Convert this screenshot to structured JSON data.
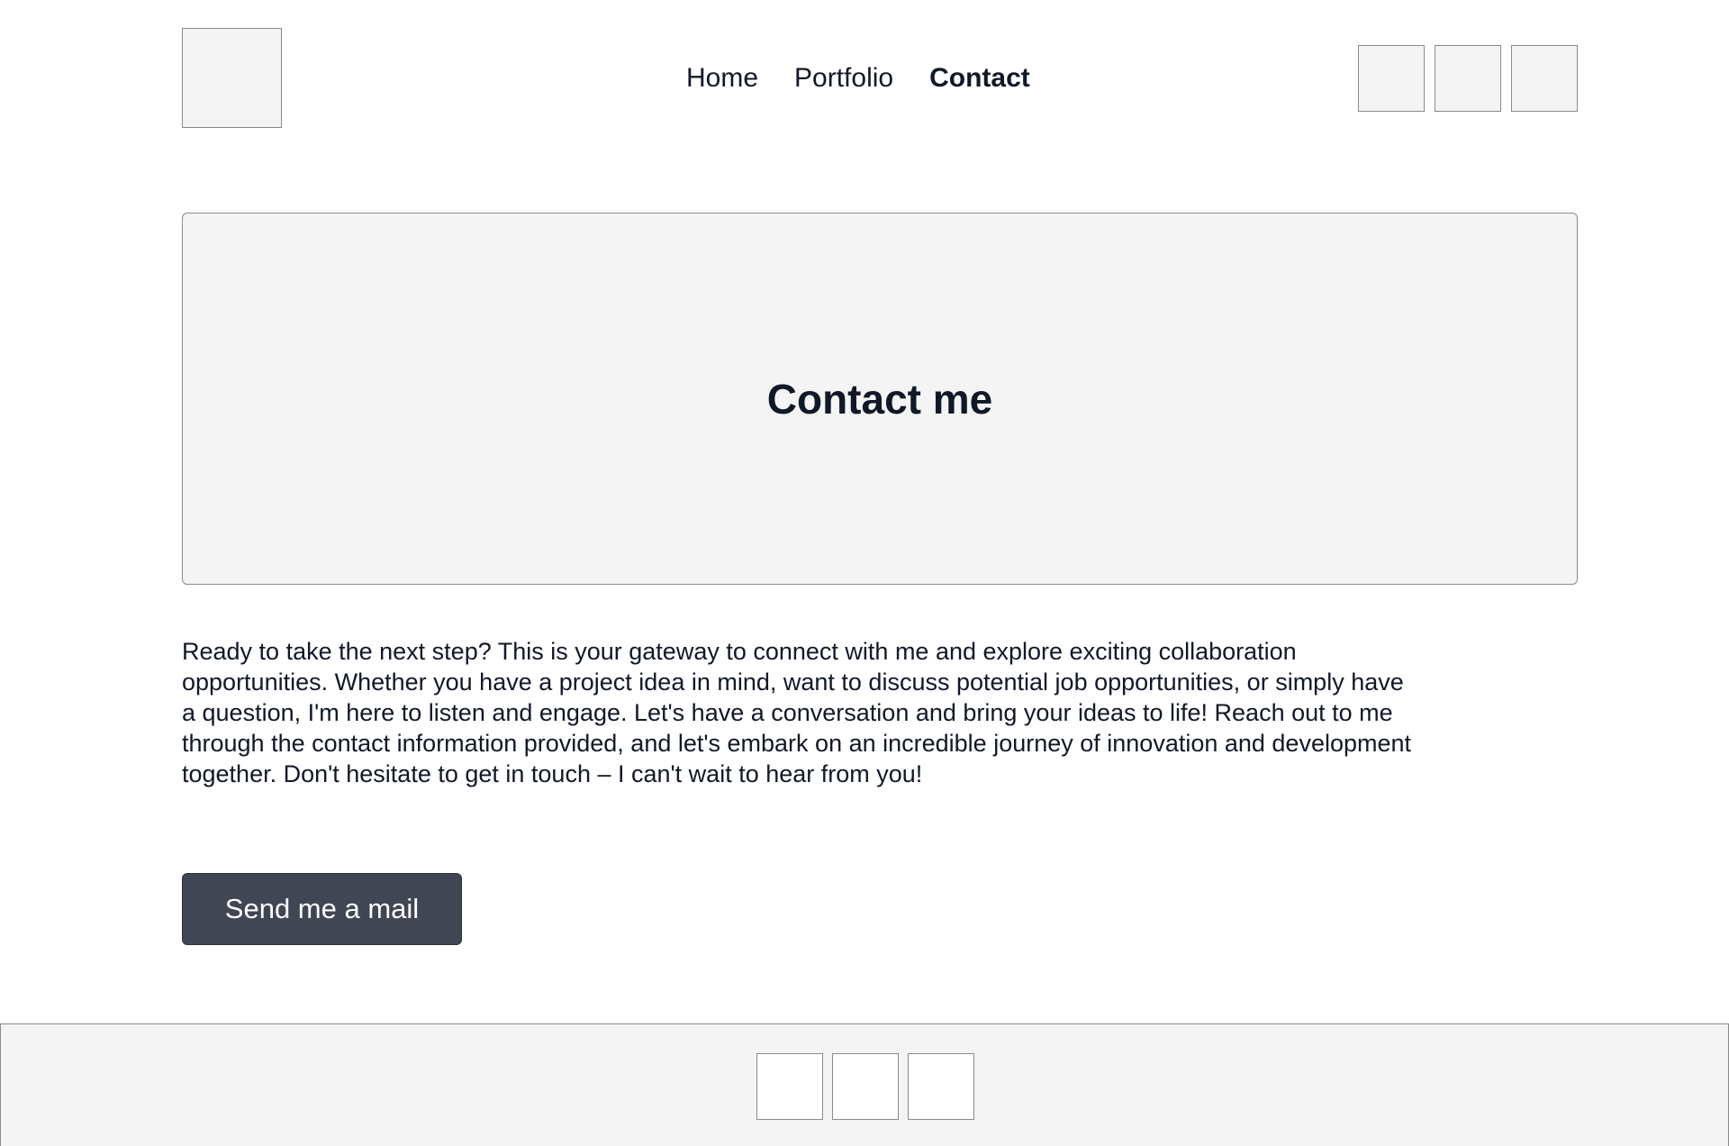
{
  "nav": {
    "items": [
      {
        "label": "Home",
        "active": false
      },
      {
        "label": "Portfolio",
        "active": false
      },
      {
        "label": "Contact",
        "active": true
      }
    ]
  },
  "hero": {
    "title": "Contact me"
  },
  "intro": {
    "text": "Ready to take the next step? This is your gateway to connect with me and explore exciting collaboration opportunities. Whether you have a project idea in mind, want to discuss potential job opportunities, or simply have a question, I'm here to listen and engage. Let's have a conversation and bring your ideas to life! Reach out to me through the contact information provided, and let's embark on an incredible journey of innovation and development together. Don't hesitate to get in touch – I can't wait to hear from you!"
  },
  "cta": {
    "label": "Send me a mail"
  },
  "colors": {
    "text": "#111827",
    "button_bg": "#414654",
    "placeholder_bg": "#f4f4f4",
    "placeholder_border": "#8a8a8a"
  }
}
